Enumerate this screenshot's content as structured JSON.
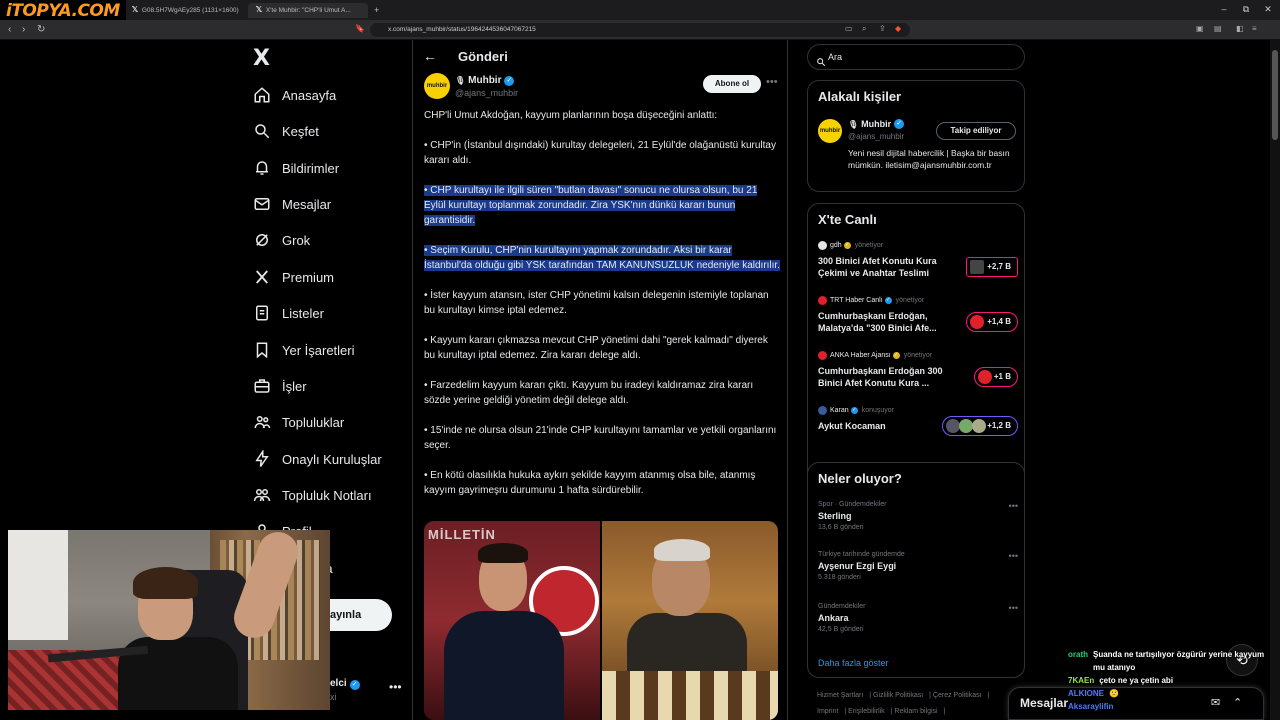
{
  "browser": {
    "site_logo": "iTOPYA.COM",
    "tabs": [
      {
        "label": "G08.5H7WgAEy285 (1131×1600)"
      },
      {
        "label": "Muhbir: \"CHP'li Umut A...",
        "prefix": "X'te"
      }
    ],
    "new_tab": "+",
    "url": "x.com/ajans_muhbir/status/1964244536047067215"
  },
  "sidebar": {
    "logo": "X",
    "items": [
      {
        "label": "Anasayfa",
        "icon": "home-icon"
      },
      {
        "label": "Keşfet",
        "icon": "search-icon"
      },
      {
        "label": "Bildirimler",
        "icon": "bell-icon"
      },
      {
        "label": "Mesajlar",
        "icon": "mail-icon"
      },
      {
        "label": "Grok",
        "icon": "grok-icon"
      },
      {
        "label": "Premium",
        "icon": "x-premium-icon"
      },
      {
        "label": "Listeler",
        "icon": "list-icon"
      },
      {
        "label": "Yer İşaretleri",
        "icon": "bookmark-icon"
      },
      {
        "label": "İşler",
        "icon": "briefcase-icon"
      },
      {
        "label": "Topluluklar",
        "icon": "people-icon"
      },
      {
        "label": "Onaylı Kuruluşlar",
        "icon": "lightning-icon"
      },
      {
        "label": "Topluluk Notları",
        "icon": "notes-icon"
      },
      {
        "label": "Profil",
        "icon": "profile-icon"
      },
      {
        "label": "Daha fazla",
        "icon": "more-icon"
      }
    ],
    "post_button": "Gönderi yayınla",
    "visible_post_button": "ayınla",
    "visible_more": "zla",
    "visible_profile": "Profil",
    "profile_name": "elci",
    "profile_handle": "xi"
  },
  "post": {
    "header_title": "Gönderi",
    "author_name": "Muhbir",
    "author_handle": "@ajans_muhbir",
    "avatar_text": "muhbir",
    "subscribe_label": "Abone ol",
    "paragraphs": [
      {
        "text": "CHP'li Umut Akdoğan, kayyum planlarının boşa düşeceğini anlattı:",
        "highlight": false
      },
      {
        "text": "• CHP'in (İstanbul dışındaki) kurultay delegeleri, 21 Eylül'de olağanüstü kurultay kararı aldı.",
        "highlight": false
      },
      {
        "text": "• CHP kurultayı ile ilgili süren \"butlan davası\" sonucu ne olursa olsun, bu 21 Eylül kurultayı toplanmak zorundadır. Zira YSK'nın dünkü kararı bunun garantisidir.",
        "highlight": true
      },
      {
        "text": "• Seçim Kurulu, CHP'nin kurultayını yapmak zorundadır. Aksi bir karar İstanbul'da olduğu gibi YSK tarafından TAM KANUNSUZLUK nedeniyle kaldırılır.",
        "highlight": true
      },
      {
        "text": "• İster kayyum atansın, ister CHP yönetimi kalsın delegenin istemiyle toplanan bu kurultayı kimse iptal edemez.",
        "highlight": false
      },
      {
        "text": "• Kayyum kararı çıkmazsa mevcut CHP yönetimi dahi \"gerek kalmadı\" diyerek bu kurultayı iptal edemez. Zira kararı delege aldı.",
        "highlight": false
      },
      {
        "text": "• Farzedelim kayyum kararı çıktı. Kayyum bu iradeyi kaldıramaz zira kararı sözde yerine geldiği yönetim değil delege aldı.",
        "highlight": false
      },
      {
        "text": "• 15'inde ne olursa olsun 21'inde CHP kurultayını tamamlar ve yetkili organlarını seçer.",
        "highlight": false
      },
      {
        "text": "• En kötü olasılıkla hukuka aykırı şekilde kayyım atanmış olsa bile, atanmış kayyım gayrimeşru durumunu 1 hafta sürdürebilir.",
        "highlight": false
      }
    ],
    "image_left_text": "MİLLETİN"
  },
  "right": {
    "search_placeholder": "Ara",
    "related": {
      "title": "Alakalı kişiler",
      "name": "Muhbir",
      "handle": "@ajans_muhbir",
      "avatar_text": "muhbir",
      "follow_label": "Takip ediliyor",
      "bio": "Yeni nesil dijital habercilik | Başka bir basın mümkün. iletisim@ajansmuhbir.com.tr"
    },
    "live": {
      "title": "X'te Canlı",
      "items": [
        {
          "host": "gdh",
          "role": "yönetiyor",
          "title": "300 Binici Afet Konutu Kura Çekimi ve Anahtar Teslimi",
          "count": "+2,7 B",
          "avatar_color": "#e5e5e5",
          "verified_color": "#e2b719"
        },
        {
          "host": "TRT Haber Canlı",
          "role": "yönetiyor",
          "title": "Cumhurbaşkanı Erdoğan, Malatya'da \"300 Binici Afe...",
          "count": "+1,4 B",
          "avatar_color": "#e0202a",
          "verified_color": "#1d9bf0"
        },
        {
          "host": "ANKA Haber Ajansı",
          "role": "yönetiyor",
          "title": "Cumhurbaşkanı Erdoğan 300 Binici Afet Konutu Kura ...",
          "count": "+1 B",
          "avatar_color": "#e0202a",
          "verified_color": "#e2b719"
        },
        {
          "host": "Karan",
          "role": "konuşuyor",
          "title": "Aykut Kocaman",
          "count": "+1,2 B",
          "avatar_color": "#3a5a9a",
          "verified_color": "#1d9bf0"
        }
      ]
    },
    "trends": {
      "title": "Neler oluyor?",
      "items": [
        {
          "category": "Spor · Gündemdekiler",
          "name": "Sterling",
          "count": "13,6 B gönderi"
        },
        {
          "category": "Türkiye tarihinde gündemde",
          "name": "Ayşenur Ezgi Eygi",
          "count": "5.318 gönderi"
        },
        {
          "category": "Gündemdekiler",
          "name": "Ankara",
          "count": "42,5 B gönderi"
        }
      ],
      "show_more": "Daha fazla göster"
    },
    "footer": [
      "Hizmet Şartları",
      "Gizlilik Politikası",
      "Çerez Politikası",
      "Imprint",
      "Erişilebilirlik",
      "Reklam bilgisi"
    ],
    "messages_label": "Mesajlar"
  },
  "chat": [
    {
      "user": "orath",
      "color": "#21d07a",
      "message": "Şuanda ne tartışılıyor özgürür yerine kayyum mu atanıyo"
    },
    {
      "user": "7KAEn",
      "color": "#9be24a",
      "message": "çeto ne ya çetin abi"
    },
    {
      "user": "ALKIONE",
      "color": "#4a7dff",
      "message": "🙁"
    },
    {
      "user": "Aksaraylifin",
      "color": "#4a7dff",
      "message": ""
    }
  ]
}
